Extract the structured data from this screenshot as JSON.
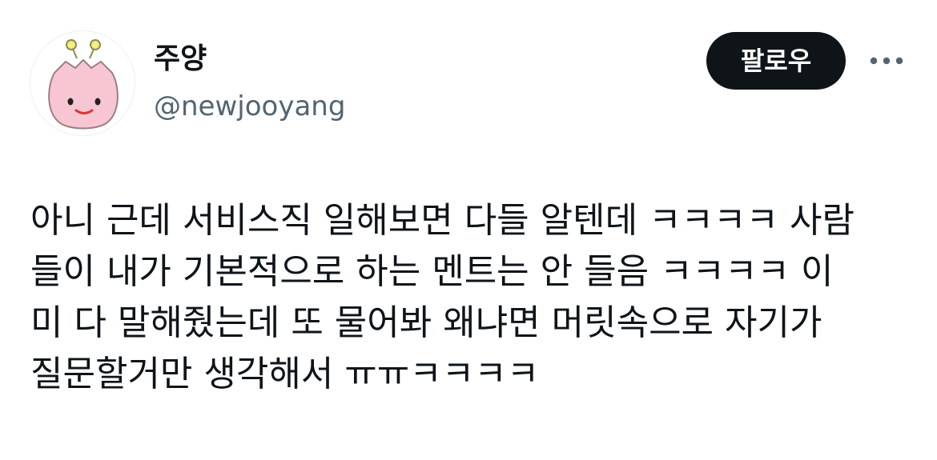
{
  "author": {
    "name": "주양",
    "handle": "@newjooyang"
  },
  "follow_button": {
    "label": "팔로우"
  },
  "more_button": {
    "icon": "more-horizontal-icon"
  },
  "tweet": {
    "lines": [
      "아니 근데 서비스직 일해보면 다들 알텐데 ㅋㅋㅋㅋ 사람",
      "들이 내가 기본적으로 하는 멘트는 안 들음 ㅋㅋㅋㅋ 이",
      "미 다 말해줬는데 또 물어봐 왜냐면 머릿속으로 자기가",
      "질문할거만 생각해서 ㅠㅠㅋㅋㅋㅋ"
    ]
  },
  "colors": {
    "text_primary": "#0f1419",
    "text_secondary": "#536471",
    "button_bg": "#0f1419",
    "avatar_pink": "#f7c6d2"
  }
}
